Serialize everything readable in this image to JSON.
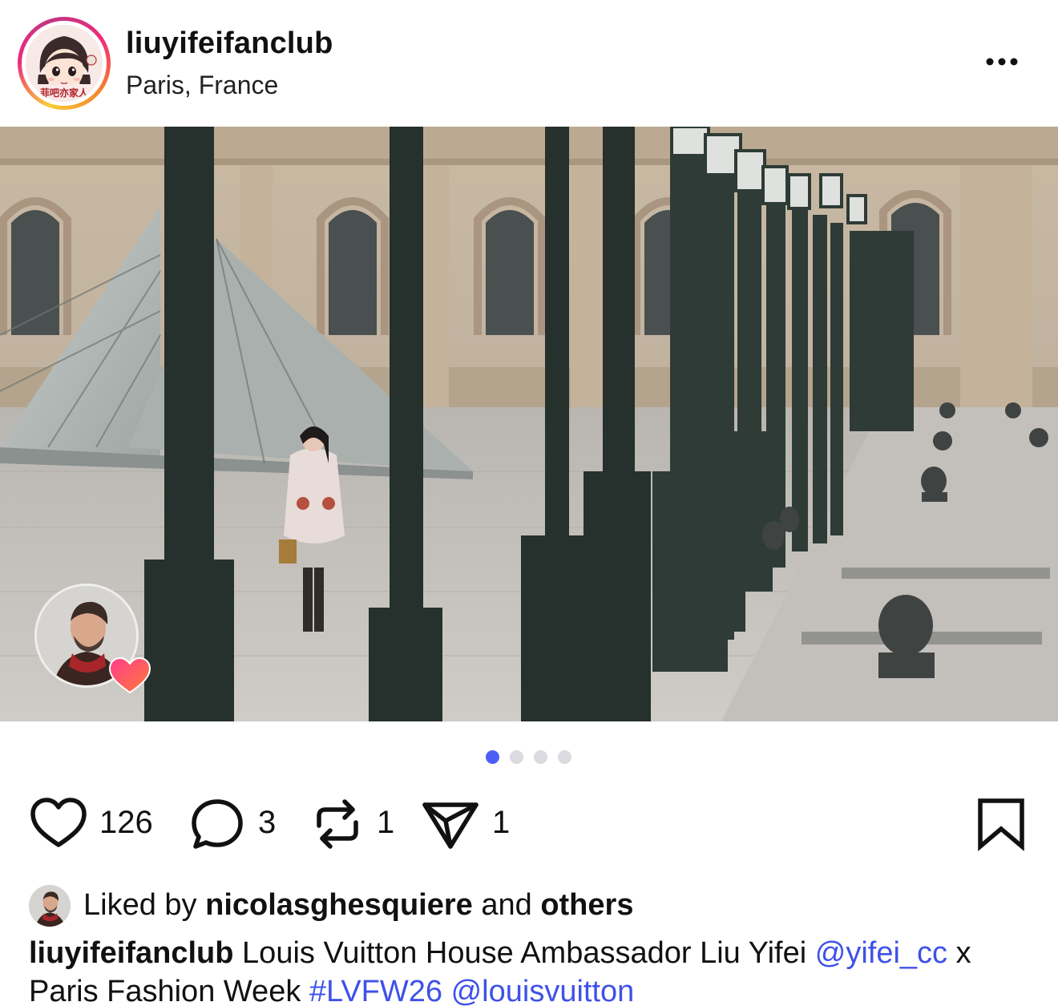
{
  "post": {
    "username": "liuyifeifanclub",
    "location": "Paris, France",
    "avatar_badge_text": "菲吧亦家人"
  },
  "icons": {
    "more": "more-horizontal-icon",
    "like": "heart-outline-icon",
    "comment": "comment-bubble-icon",
    "repost": "repost-icon",
    "share": "send-paper-plane-icon",
    "save": "bookmark-outline-icon",
    "tag_reaction": "heart-filled-icon"
  },
  "carousel": {
    "count": 4,
    "active_index": 0
  },
  "actions": {
    "likes_count": "126",
    "comments_count": "3",
    "reposts_count": "1",
    "shares_count": "1"
  },
  "likes": {
    "prefix": "Liked by",
    "liker": "nicolasghesquiere",
    "and": "and",
    "others": "others"
  },
  "caption": {
    "username": "liuyifeifanclub",
    "text1": "Louis Vuitton House Ambassador Liu Yifei",
    "mention1": "@yifei_cc",
    "text2": "x Paris Fashion Week",
    "hashtag": "#LVFW26",
    "mention2": "@louisvuitton"
  },
  "colors": {
    "link": "#3f51e8",
    "dot_active": "#4d5ef5",
    "dot_inactive": "#dadbe0",
    "heart_gradient_start": "#ff3d8b",
    "heart_gradient_end": "#ff7a3a"
  }
}
